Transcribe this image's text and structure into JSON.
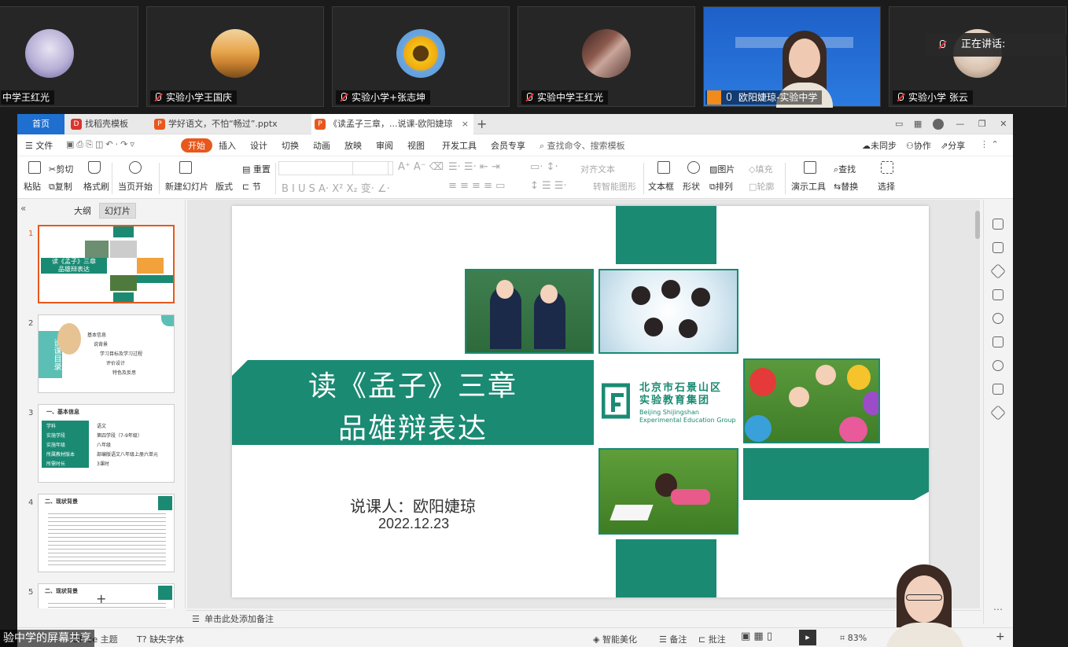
{
  "participants": [
    {
      "name": "中学王红光",
      "avatar": "anime-avatar"
    },
    {
      "name": "实验小学王国庆",
      "avatar": "field-avatar"
    },
    {
      "name": "实验小学+张志坤",
      "avatar": "sunflower-avatar"
    },
    {
      "name": "实验中学王红光",
      "avatar": "photo-avatar"
    },
    {
      "name": "欧阳婕琼-实验中学",
      "avatar": "video-feed"
    },
    {
      "name": "实验小学  张云",
      "avatar": "person-avatar"
    }
  ],
  "speaking_label": "正在讲话:",
  "tabs": {
    "home": "首页",
    "template": "找稻壳模板",
    "file1": "学好语文，不怕“畅过”.pptx",
    "file2": "《读孟子三章，...说课-欧阳婕琼"
  },
  "menu": {
    "file": "文件",
    "items": [
      "开始",
      "插入",
      "设计",
      "切换",
      "动画",
      "放映",
      "审阅",
      "视图",
      "开发工具",
      "会员专享"
    ],
    "search": "查找命令、搜索模板",
    "sync": "未同步",
    "collab": "协作",
    "share": "分享"
  },
  "ribbon": {
    "paste": "粘贴",
    "cut": "剪切",
    "copy": "复制",
    "format_brush": "格式刷",
    "from_current": "当页开始",
    "new_slide": "新建幻灯片",
    "layout": "版式",
    "section": "节",
    "reset": "重置",
    "text_box": "文本框",
    "shape": "形状",
    "arrange": "排列",
    "picture": "图片",
    "fill": "填充",
    "outline": "轮廓",
    "presentation_tools": "演示工具",
    "find": "查找",
    "replace": "替换",
    "select": "选择",
    "align_text": "对齐文本",
    "smart_graphic": "转智能图形"
  },
  "left_pane": {
    "outline_tab": "大纲",
    "slides_tab": "幻灯片",
    "slide_numbers": [
      "1",
      "2",
      "3",
      "4",
      "5"
    ],
    "thumb2_title": "说课目录",
    "thumb2_items": [
      "基本信息",
      "说背景",
      "学习目标及学习过程",
      "评价设计",
      "特色及反思"
    ],
    "thumb3_title": "一、基本信息",
    "thumb3_rows": [
      {
        "k": "学科",
        "v": "语文"
      },
      {
        "k": "实施学段",
        "v": "第四学段（7-9年级）"
      },
      {
        "k": "实施年级",
        "v": "八年级"
      },
      {
        "k": "所属教材版本",
        "v": "部编版语文八年级上册六单元"
      },
      {
        "k": "所需时长",
        "v": "3课时"
      }
    ],
    "thumb4_title": "二、现状背景",
    "thumb5_title": "二、现状背景"
  },
  "slide": {
    "title_line1": "读《孟子》三章",
    "title_line2": "品雄辩表达",
    "lecturer": "说课人：欧阳婕琼",
    "date": "2022.12.23",
    "logo_cn_line1": "北京市石景山区",
    "logo_cn_line2": "实验教育集团",
    "logo_en_line1": "Beijing Shijingshan",
    "logo_en_line2": "Experimental Education Group"
  },
  "notes_placeholder": "单击此处添加备注",
  "status": {
    "theme": "Office 主题",
    "missing_font": "缺失字体",
    "smart_beautify": "智能美化",
    "notes": "备注",
    "comments": "批注",
    "zoom": "83%"
  },
  "share_label": "验中学的屏幕共享",
  "colors": {
    "accent": "#1a8a73",
    "wps_orange": "#e8581c",
    "home_blue": "#1f6fd0"
  }
}
